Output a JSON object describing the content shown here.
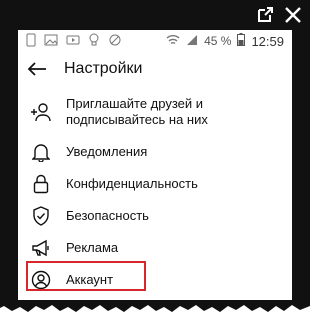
{
  "status_bar": {
    "battery_percent": "45 %",
    "time": "12:59"
  },
  "header": {
    "title": "Настройки"
  },
  "menu": {
    "items": [
      {
        "label": "Приглашайте друзей и подписывайтесь на них",
        "icon": "add-person-icon"
      },
      {
        "label": "Уведомления",
        "icon": "bell-icon"
      },
      {
        "label": "Конфиденциальность",
        "icon": "lock-icon"
      },
      {
        "label": "Безопасность",
        "icon": "shield-check-icon"
      },
      {
        "label": "Реклама",
        "icon": "megaphone-icon"
      },
      {
        "label": "Аккаунт",
        "icon": "account-icon"
      }
    ]
  },
  "colors": {
    "highlight": "#d8262d",
    "frame": "#111111"
  }
}
